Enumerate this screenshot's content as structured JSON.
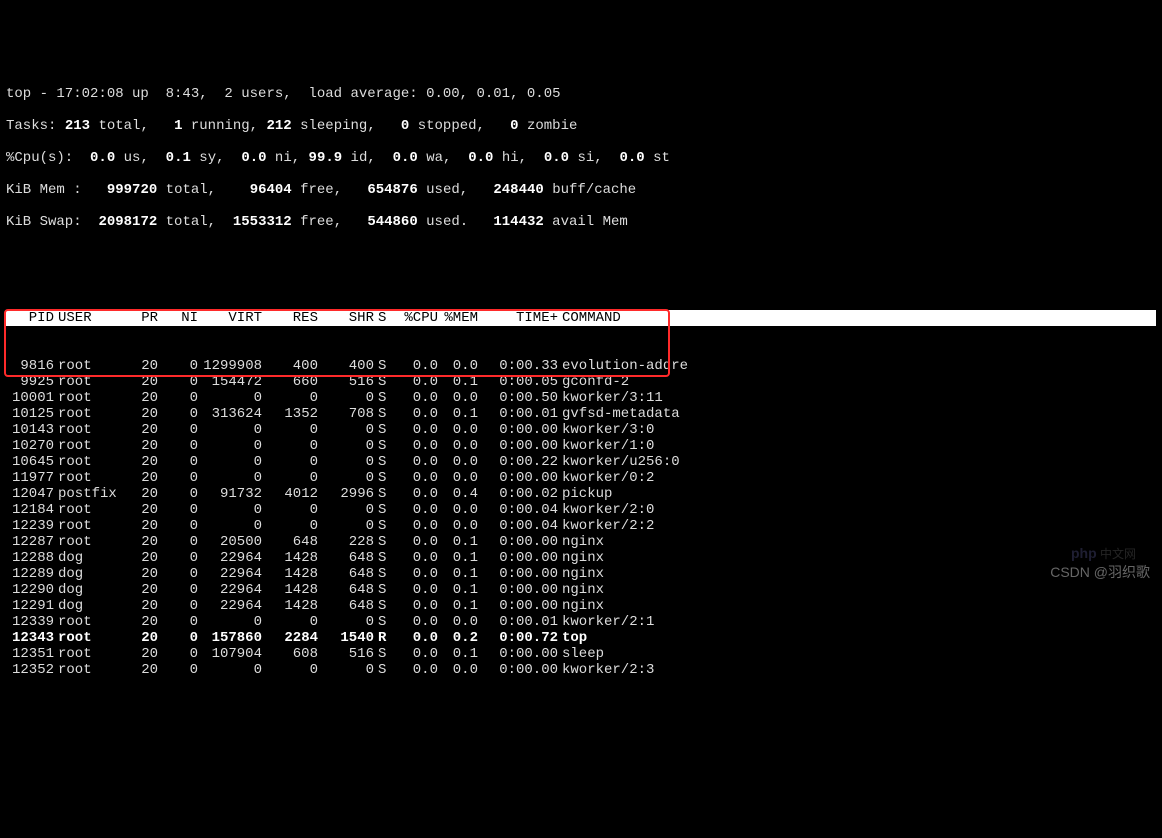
{
  "summary": {
    "line1": "top - 17:02:08 up  8:43,  2 users,  load average: 0.00, 0.01, 0.05",
    "tasks_label": "Tasks:",
    "tasks_total": "213",
    "tasks_running": "1",
    "tasks_sleeping": "212",
    "tasks_stopped": "0",
    "tasks_zombie": "0",
    "cpu_label": "%Cpu(s):",
    "cpu_us": "0.0",
    "cpu_sy": "0.1",
    "cpu_ni": "0.0",
    "cpu_id": "99.9",
    "cpu_wa": "0.0",
    "cpu_hi": "0.0",
    "cpu_si": "0.0",
    "cpu_st": "0.0",
    "mem_label": "KiB Mem :",
    "mem_total": "999720",
    "mem_free": "96404",
    "mem_used": "654876",
    "mem_buff": "248440",
    "swap_label": "KiB Swap:",
    "swap_total": "2098172",
    "swap_free": "1553312",
    "swap_used": "544860",
    "swap_avail": "114432"
  },
  "columns": {
    "pid": "PID",
    "user": "USER",
    "pr": "PR",
    "ni": "NI",
    "virt": "VIRT",
    "res": "RES",
    "shr": "SHR",
    "s": "S",
    "cpu": "%CPU",
    "mem": "%MEM",
    "time": "TIME+",
    "cmd": "COMMAND"
  },
  "rows": [
    {
      "pid": "9816",
      "user": "root",
      "pr": "20",
      "ni": "0",
      "virt": "1299908",
      "res": "400",
      "shr": "400",
      "s": "S",
      "cpu": "0.0",
      "mem": "0.0",
      "time": "0:00.33",
      "cmd": "evolution-addre",
      "bold": false
    },
    {
      "pid": "9925",
      "user": "root",
      "pr": "20",
      "ni": "0",
      "virt": "154472",
      "res": "660",
      "shr": "516",
      "s": "S",
      "cpu": "0.0",
      "mem": "0.1",
      "time": "0:00.05",
      "cmd": "gconfd-2",
      "bold": false
    },
    {
      "pid": "10001",
      "user": "root",
      "pr": "20",
      "ni": "0",
      "virt": "0",
      "res": "0",
      "shr": "0",
      "s": "S",
      "cpu": "0.0",
      "mem": "0.0",
      "time": "0:00.50",
      "cmd": "kworker/3:11",
      "bold": false
    },
    {
      "pid": "10125",
      "user": "root",
      "pr": "20",
      "ni": "0",
      "virt": "313624",
      "res": "1352",
      "shr": "708",
      "s": "S",
      "cpu": "0.0",
      "mem": "0.1",
      "time": "0:00.01",
      "cmd": "gvfsd-metadata",
      "bold": false
    },
    {
      "pid": "10143",
      "user": "root",
      "pr": "20",
      "ni": "0",
      "virt": "0",
      "res": "0",
      "shr": "0",
      "s": "S",
      "cpu": "0.0",
      "mem": "0.0",
      "time": "0:00.00",
      "cmd": "kworker/3:0",
      "bold": false
    },
    {
      "pid": "10270",
      "user": "root",
      "pr": "20",
      "ni": "0",
      "virt": "0",
      "res": "0",
      "shr": "0",
      "s": "S",
      "cpu": "0.0",
      "mem": "0.0",
      "time": "0:00.00",
      "cmd": "kworker/1:0",
      "bold": false
    },
    {
      "pid": "10645",
      "user": "root",
      "pr": "20",
      "ni": "0",
      "virt": "0",
      "res": "0",
      "shr": "0",
      "s": "S",
      "cpu": "0.0",
      "mem": "0.0",
      "time": "0:00.22",
      "cmd": "kworker/u256:0",
      "bold": false
    },
    {
      "pid": "11977",
      "user": "root",
      "pr": "20",
      "ni": "0",
      "virt": "0",
      "res": "0",
      "shr": "0",
      "s": "S",
      "cpu": "0.0",
      "mem": "0.0",
      "time": "0:00.00",
      "cmd": "kworker/0:2",
      "bold": false
    },
    {
      "pid": "12047",
      "user": "postfix",
      "pr": "20",
      "ni": "0",
      "virt": "91732",
      "res": "4012",
      "shr": "2996",
      "s": "S",
      "cpu": "0.0",
      "mem": "0.4",
      "time": "0:00.02",
      "cmd": "pickup",
      "bold": false
    },
    {
      "pid": "12184",
      "user": "root",
      "pr": "20",
      "ni": "0",
      "virt": "0",
      "res": "0",
      "shr": "0",
      "s": "S",
      "cpu": "0.0",
      "mem": "0.0",
      "time": "0:00.04",
      "cmd": "kworker/2:0",
      "bold": false
    },
    {
      "pid": "12239",
      "user": "root",
      "pr": "20",
      "ni": "0",
      "virt": "0",
      "res": "0",
      "shr": "0",
      "s": "S",
      "cpu": "0.0",
      "mem": "0.0",
      "time": "0:00.04",
      "cmd": "kworker/2:2",
      "bold": false
    },
    {
      "pid": "12287",
      "user": "root",
      "pr": "20",
      "ni": "0",
      "virt": "20500",
      "res": "648",
      "shr": "228",
      "s": "S",
      "cpu": "0.0",
      "mem": "0.1",
      "time": "0:00.00",
      "cmd": "nginx",
      "bold": false
    },
    {
      "pid": "12288",
      "user": "dog",
      "pr": "20",
      "ni": "0",
      "virt": "22964",
      "res": "1428",
      "shr": "648",
      "s": "S",
      "cpu": "0.0",
      "mem": "0.1",
      "time": "0:00.00",
      "cmd": "nginx",
      "bold": false
    },
    {
      "pid": "12289",
      "user": "dog",
      "pr": "20",
      "ni": "0",
      "virt": "22964",
      "res": "1428",
      "shr": "648",
      "s": "S",
      "cpu": "0.0",
      "mem": "0.1",
      "time": "0:00.00",
      "cmd": "nginx",
      "bold": false
    },
    {
      "pid": "12290",
      "user": "dog",
      "pr": "20",
      "ni": "0",
      "virt": "22964",
      "res": "1428",
      "shr": "648",
      "s": "S",
      "cpu": "0.0",
      "mem": "0.1",
      "time": "0:00.00",
      "cmd": "nginx",
      "bold": false
    },
    {
      "pid": "12291",
      "user": "dog",
      "pr": "20",
      "ni": "0",
      "virt": "22964",
      "res": "1428",
      "shr": "648",
      "s": "S",
      "cpu": "0.0",
      "mem": "0.1",
      "time": "0:00.00",
      "cmd": "nginx",
      "bold": false
    },
    {
      "pid": "12339",
      "user": "root",
      "pr": "20",
      "ni": "0",
      "virt": "0",
      "res": "0",
      "shr": "0",
      "s": "S",
      "cpu": "0.0",
      "mem": "0.0",
      "time": "0:00.01",
      "cmd": "kworker/2:1",
      "bold": false
    },
    {
      "pid": "12343",
      "user": "root",
      "pr": "20",
      "ni": "0",
      "virt": "157860",
      "res": "2284",
      "shr": "1540",
      "s": "R",
      "cpu": "0.0",
      "mem": "0.2",
      "time": "0:00.72",
      "cmd": "top",
      "bold": true
    },
    {
      "pid": "12351",
      "user": "root",
      "pr": "20",
      "ni": "0",
      "virt": "107904",
      "res": "608",
      "shr": "516",
      "s": "S",
      "cpu": "0.0",
      "mem": "0.1",
      "time": "0:00.00",
      "cmd": "sleep",
      "bold": false
    },
    {
      "pid": "12352",
      "user": "root",
      "pr": "20",
      "ni": "0",
      "virt": "0",
      "res": "0",
      "shr": "0",
      "s": "S",
      "cpu": "0.0",
      "mem": "0.0",
      "time": "0:00.00",
      "cmd": "kworker/2:3",
      "bold": false
    }
  ],
  "watermark": "CSDN @羽织歌",
  "logo": "php 中文网"
}
